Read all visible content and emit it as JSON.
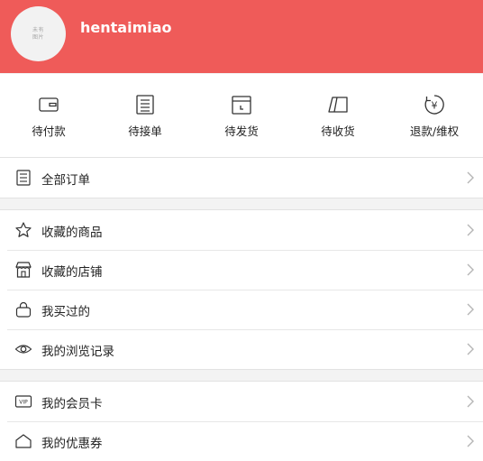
{
  "profile": {
    "avatar_text_line1": "未有",
    "avatar_text_line2": "图片",
    "username": "hentaimiao"
  },
  "colors": {
    "header_bg": "#ef5b59",
    "page_bg": "#f3f3f3"
  },
  "orders": [
    {
      "label": "待付款",
      "icon": "wallet-icon"
    },
    {
      "label": "待接单",
      "icon": "document-icon"
    },
    {
      "label": "待发货",
      "icon": "box-icon"
    },
    {
      "label": "待收货",
      "icon": "truck-icon"
    },
    {
      "label": "退款/维权",
      "icon": "refund-icon"
    }
  ],
  "all_orders": {
    "label": "全部订单",
    "icon": "list-icon"
  },
  "menu_group1": [
    {
      "label": "收藏的商品",
      "icon": "star-icon"
    },
    {
      "label": "收藏的店铺",
      "icon": "store-icon"
    },
    {
      "label": "我买过的",
      "icon": "bag-icon"
    },
    {
      "label": "我的浏览记录",
      "icon": "eye-icon"
    }
  ],
  "menu_group2": [
    {
      "label": "我的会员卡",
      "icon": "vip-card-icon"
    },
    {
      "label": "我的优惠券",
      "icon": "coupon-icon"
    }
  ]
}
